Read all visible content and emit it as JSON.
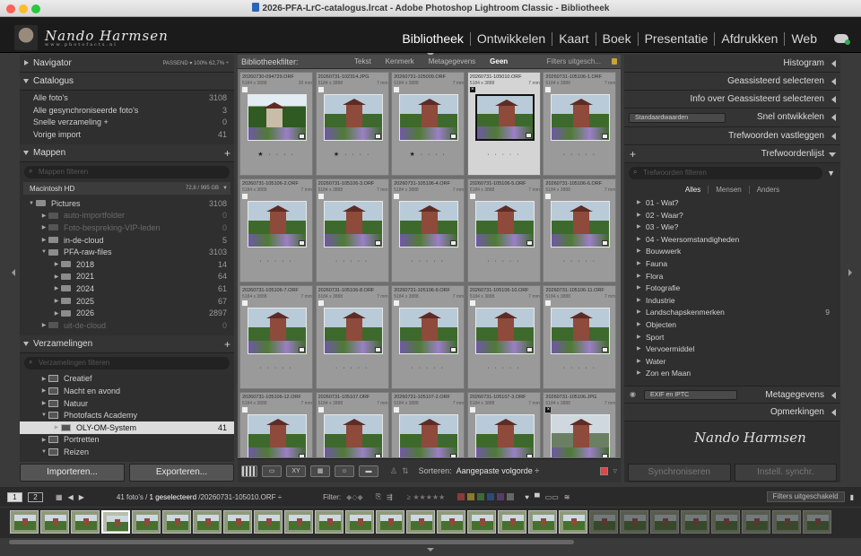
{
  "window": {
    "title": "2026-PFA-LrC-catalogus.lrcat - Adobe Photoshop Lightroom Classic - Bibliotheek"
  },
  "identity": {
    "signature": "Nando Harmsen",
    "sub": "www.photofacts.nl"
  },
  "modules": [
    "Bibliotheek",
    "Ontwikkelen",
    "Kaart",
    "Boek",
    "Presentatie",
    "Afdrukken",
    "Web"
  ],
  "left": {
    "navigator": {
      "title": "Navigator",
      "opts": "PASSEND ▾   100%   62,7% ÷"
    },
    "catalog": {
      "title": "Catalogus",
      "items": [
        {
          "label": "Alle foto's",
          "count": "3108"
        },
        {
          "label": "Alle gesynchroniseerde foto's",
          "count": "3"
        },
        {
          "label": "Snelle verzameling +",
          "count": "0"
        },
        {
          "label": "Vorige import",
          "count": "41"
        }
      ]
    },
    "folders": {
      "title": "Mappen",
      "filter": "Mappen filteren",
      "volume": "Macintosh HD",
      "capacity": "72,8 / 995 GB",
      "items": [
        {
          "label": "Pictures",
          "count": "3108",
          "indent": 0,
          "open": true,
          "dim": false
        },
        {
          "label": "auto-importfolder",
          "count": "0",
          "indent": 1,
          "open": false,
          "dim": true
        },
        {
          "label": "Foto-bespreking-VIP-leden",
          "count": "0",
          "indent": 1,
          "open": false,
          "dim": true
        },
        {
          "label": "in-de-cloud",
          "count": "5",
          "indent": 1,
          "open": false,
          "dim": false
        },
        {
          "label": "PFA-raw-files",
          "count": "3103",
          "indent": 1,
          "open": true,
          "dim": false
        },
        {
          "label": "2018",
          "count": "14",
          "indent": 2,
          "open": false,
          "dim": false
        },
        {
          "label": "2021",
          "count": "64",
          "indent": 2,
          "open": false,
          "dim": false
        },
        {
          "label": "2024",
          "count": "61",
          "indent": 2,
          "open": false,
          "dim": false
        },
        {
          "label": "2025",
          "count": "67",
          "indent": 2,
          "open": false,
          "dim": false
        },
        {
          "label": "2026",
          "count": "2897",
          "indent": 2,
          "open": false,
          "dim": false
        },
        {
          "label": "uit-de-cloud",
          "count": "0",
          "indent": 1,
          "open": false,
          "dim": true
        }
      ]
    },
    "collections": {
      "title": "Verzamelingen",
      "filter": "Verzamelingen filteren",
      "items": [
        {
          "label": "Creatief",
          "count": "",
          "indent": 1,
          "sel": false
        },
        {
          "label": "Nacht en avond",
          "count": "",
          "indent": 1,
          "sel": false
        },
        {
          "label": "Natuur",
          "count": "",
          "indent": 1,
          "sel": false
        },
        {
          "label": "Photofacts Academy",
          "count": "",
          "indent": 1,
          "sel": false
        },
        {
          "label": "OLY-OM-System",
          "count": "41",
          "indent": 2,
          "sel": true
        },
        {
          "label": "Portretten",
          "count": "",
          "indent": 1,
          "sel": false
        },
        {
          "label": "Reizen",
          "count": "",
          "indent": 1,
          "sel": false
        }
      ]
    },
    "import_label": "Importeren...",
    "export_label": "Exporteren..."
  },
  "libfilter": {
    "label": "Bibliotheekfilter:",
    "options": [
      "Tekst",
      "Kenmerk",
      "Metagegevens",
      "Geen"
    ],
    "filters": "Filters uitgesch..."
  },
  "grid": {
    "cells": [
      {
        "name": "20260730-094729.ORF",
        "info": "5184 x 3888",
        "ext": "20 mm",
        "flag": "white",
        "stars": "★ · · · ·",
        "sel": false,
        "img": "green"
      },
      {
        "name": "20260731-102314.JPG",
        "info": "5184 x 3888",
        "ext": "7 mm",
        "flag": "white",
        "stars": "★ · · · ·",
        "sel": false,
        "img": "castle"
      },
      {
        "name": "20260731-105009.ORF",
        "info": "5184 x 3888",
        "ext": "7 mm",
        "flag": "white",
        "stars": "★ · · · ·",
        "sel": false,
        "img": "castle"
      },
      {
        "name": "20260731-105010.ORF",
        "info": "5184 x 3888",
        "ext": "7 mm",
        "flag": "x",
        "stars": "· · · · ·",
        "sel": true,
        "img": "castle"
      },
      {
        "name": "20260731-105106-1.ORF",
        "info": "5184 x 3888",
        "ext": "7 mm",
        "flag": "white",
        "stars": "· · · · ·",
        "sel": false,
        "img": "castle"
      },
      {
        "name": "20260731-105106-2.ORF",
        "info": "5184 x 3888",
        "ext": "7 mm",
        "flag": "white",
        "stars": "· · · · ·",
        "sel": false,
        "img": "castle"
      },
      {
        "name": "20260731-105106-3.ORF",
        "info": "5184 x 3888",
        "ext": "7 mm",
        "flag": "white",
        "stars": "· · · · ·",
        "sel": false,
        "img": "castle"
      },
      {
        "name": "20260731-105106-4.ORF",
        "info": "5184 x 3888",
        "ext": "7 mm",
        "flag": "white",
        "stars": "· · · · ·",
        "sel": false,
        "img": "castle"
      },
      {
        "name": "20260731-105106-5.ORF",
        "info": "5184 x 3888",
        "ext": "7 mm",
        "flag": "white",
        "stars": "· · · · ·",
        "sel": false,
        "img": "castle"
      },
      {
        "name": "20260731-105106-6.ORF",
        "info": "5184 x 3888",
        "ext": "7 mm",
        "flag": "white",
        "stars": "· · · · ·",
        "sel": false,
        "img": "castle"
      },
      {
        "name": "20260731-105106-7.ORF",
        "info": "5184 x 3888",
        "ext": "7 mm",
        "flag": "white",
        "stars": "· · · · ·",
        "sel": false,
        "img": "castle"
      },
      {
        "name": "20260731-105106-8.ORF",
        "info": "5184 x 3888",
        "ext": "7 mm",
        "flag": "white",
        "stars": "· · · · ·",
        "sel": false,
        "img": "castle"
      },
      {
        "name": "20260731-105106-9.ORF",
        "info": "5184 x 3888",
        "ext": "7 mm",
        "flag": "white",
        "stars": "· · · · ·",
        "sel": false,
        "img": "castle"
      },
      {
        "name": "20260731-105106-10.ORF",
        "info": "5184 x 3888",
        "ext": "7 mm",
        "flag": "white",
        "stars": "· · · · ·",
        "sel": false,
        "img": "castle"
      },
      {
        "name": "20260731-105106-11.ORF",
        "info": "5184 x 3888",
        "ext": "7 mm",
        "flag": "white",
        "stars": "· · · · ·",
        "sel": false,
        "img": "castle"
      },
      {
        "name": "20260731-105106-12.ORF",
        "info": "5184 x 3888",
        "ext": "7 mm",
        "flag": "white",
        "stars": "",
        "sel": false,
        "img": "castle"
      },
      {
        "name": "20260731-105107.ORF",
        "info": "5184 x 3888",
        "ext": "7 mm",
        "flag": "white",
        "stars": "",
        "sel": false,
        "img": "castle"
      },
      {
        "name": "20260731-105107-2.ORF",
        "info": "5184 x 3888",
        "ext": "7 mm",
        "flag": "white",
        "stars": "",
        "sel": false,
        "img": "castle"
      },
      {
        "name": "20260731-105107-3.ORF",
        "info": "5184 x 3888",
        "ext": "7 mm",
        "flag": "white",
        "stars": "",
        "sel": false,
        "img": "castle"
      },
      {
        "name": "20260731-105106.JPG",
        "info": "5184 x 3888",
        "ext": "7 mm",
        "flag": "x",
        "stars": "",
        "sel": false,
        "img": "grey"
      }
    ],
    "sort_label": "Sorteren:",
    "sort_value": "Aangepaste volgorde ÷",
    "accent": "#e04545"
  },
  "right": {
    "histogram": "Histogram",
    "panels": [
      "Geassisteerd selecteren",
      "Info over Geassisteerd selecteren",
      "Snel ontwikkelen",
      "Trefwoorden vastleggen",
      "Trefwoordenlijst"
    ],
    "quick_develop_preset": "Standaardwaarden",
    "keyword_filter": "Trefwoorden filteren",
    "keyword_tabs": [
      "Alles",
      "Mensen",
      "Anders"
    ],
    "keywords": [
      {
        "label": "01 - Wat?",
        "count": ""
      },
      {
        "label": "02 - Waar?",
        "count": ""
      },
      {
        "label": "03 - Wie?",
        "count": ""
      },
      {
        "label": "04 - Weersomstandigheden",
        "count": ""
      },
      {
        "label": "Bouwwerk",
        "count": ""
      },
      {
        "label": "Fauna",
        "count": ""
      },
      {
        "label": "Flora",
        "count": ""
      },
      {
        "label": "Fotografie",
        "count": ""
      },
      {
        "label": "Industrie",
        "count": ""
      },
      {
        "label": "Landschapskenmerken",
        "count": "9"
      },
      {
        "label": "Objecten",
        "count": ""
      },
      {
        "label": "Sport",
        "count": ""
      },
      {
        "label": "Vervoermiddel",
        "count": ""
      },
      {
        "label": "Water",
        "count": ""
      },
      {
        "label": "Zon en Maan",
        "count": ""
      }
    ],
    "metadata_preset": "EXIF en IPTC",
    "metadata": "Metagegevens",
    "comments": "Opmerkingen",
    "sync_label": "Synchroniseren",
    "settings_label": "Instell. synchr."
  },
  "filmbar": {
    "screen1": "1",
    "screen2": "2",
    "count_text": "41 foto's /",
    "selected_text": "1 geselecteerd",
    "file_text": "/20260731-105010.ORF ÷",
    "filter_label": "Filter:",
    "filter_state": "Filters uitgeschakeld"
  },
  "filmstrip": {
    "total": 27,
    "selected_index": 3,
    "dim_from": 19
  }
}
